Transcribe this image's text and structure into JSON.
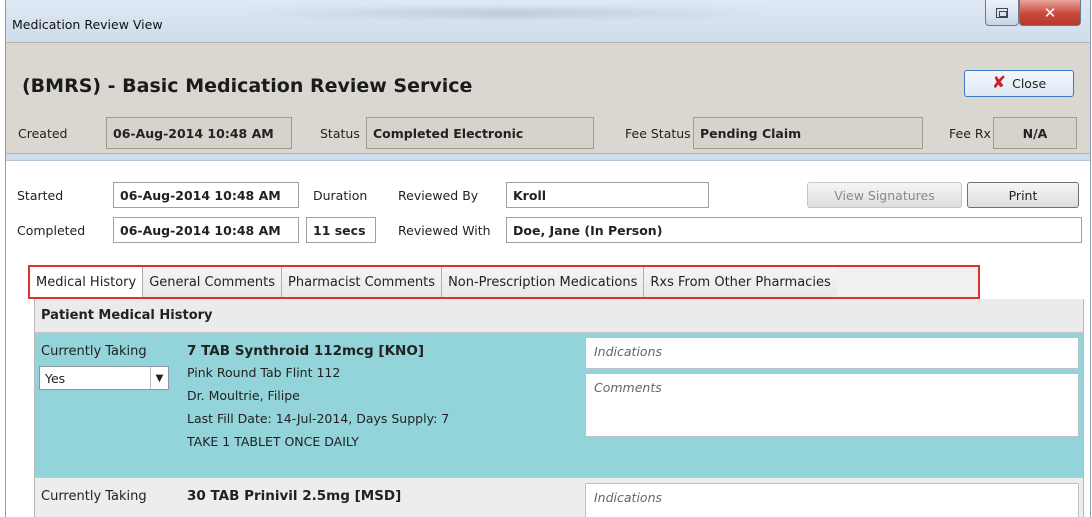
{
  "window": {
    "title": "Medication Review View"
  },
  "header": {
    "service_title": "(BMRS) - Basic Medication Review Service",
    "close_label": "Close",
    "created_label": "Created",
    "created_value": "06-Aug-2014 10:48 AM",
    "status_label": "Status",
    "status_value": "Completed Electronic",
    "fee_status_label": "Fee Status",
    "fee_status_value": "Pending Claim",
    "fee_rx_label": "Fee Rx",
    "fee_rx_value": "N/A"
  },
  "review": {
    "started_label": "Started",
    "started_value": "06-Aug-2014 10:48 AM",
    "completed_label": "Completed",
    "completed_value": "06-Aug-2014 10:48 AM",
    "duration_label": "Duration",
    "duration_value": "11 secs",
    "reviewed_by_label": "Reviewed By",
    "reviewed_by_value": "Kroll",
    "reviewed_with_label": "Reviewed With",
    "reviewed_with_value": "Doe, Jane (In Person)",
    "view_signatures_label": "View Signatures",
    "print_label": "Print"
  },
  "tabs": [
    {
      "label": "Medical History",
      "active": true
    },
    {
      "label": "General Comments",
      "active": false
    },
    {
      "label": "Pharmacist Comments",
      "active": false
    },
    {
      "label": "Non-Prescription Medications",
      "active": false
    },
    {
      "label": "Rxs From Other Pharmacies",
      "active": false
    }
  ],
  "section": {
    "title": "Patient Medical History"
  },
  "medications": [
    {
      "currently_taking_label": "Currently Taking",
      "currently_taking_value": "Yes",
      "name": "7 TAB Synthroid 112mcg [KNO]",
      "description": "Pink Round Tab Flint 112",
      "doctor": "Dr. Moultrie, Filipe",
      "fill_info": "Last Fill Date: 14-Jul-2014, Days Supply: 7",
      "directions": "TAKE 1 TABLET ONCE DAILY",
      "indications_placeholder": "Indications",
      "comments_placeholder": "Comments"
    },
    {
      "currently_taking_label": "Currently Taking",
      "name": "30 TAB Prinivil 2.5mg [MSD]",
      "indications_placeholder": "Indications"
    }
  ],
  "colors": {
    "selected_row": "#93d3da",
    "tab_highlight": "#e03131",
    "close_x": "#c8202a"
  }
}
